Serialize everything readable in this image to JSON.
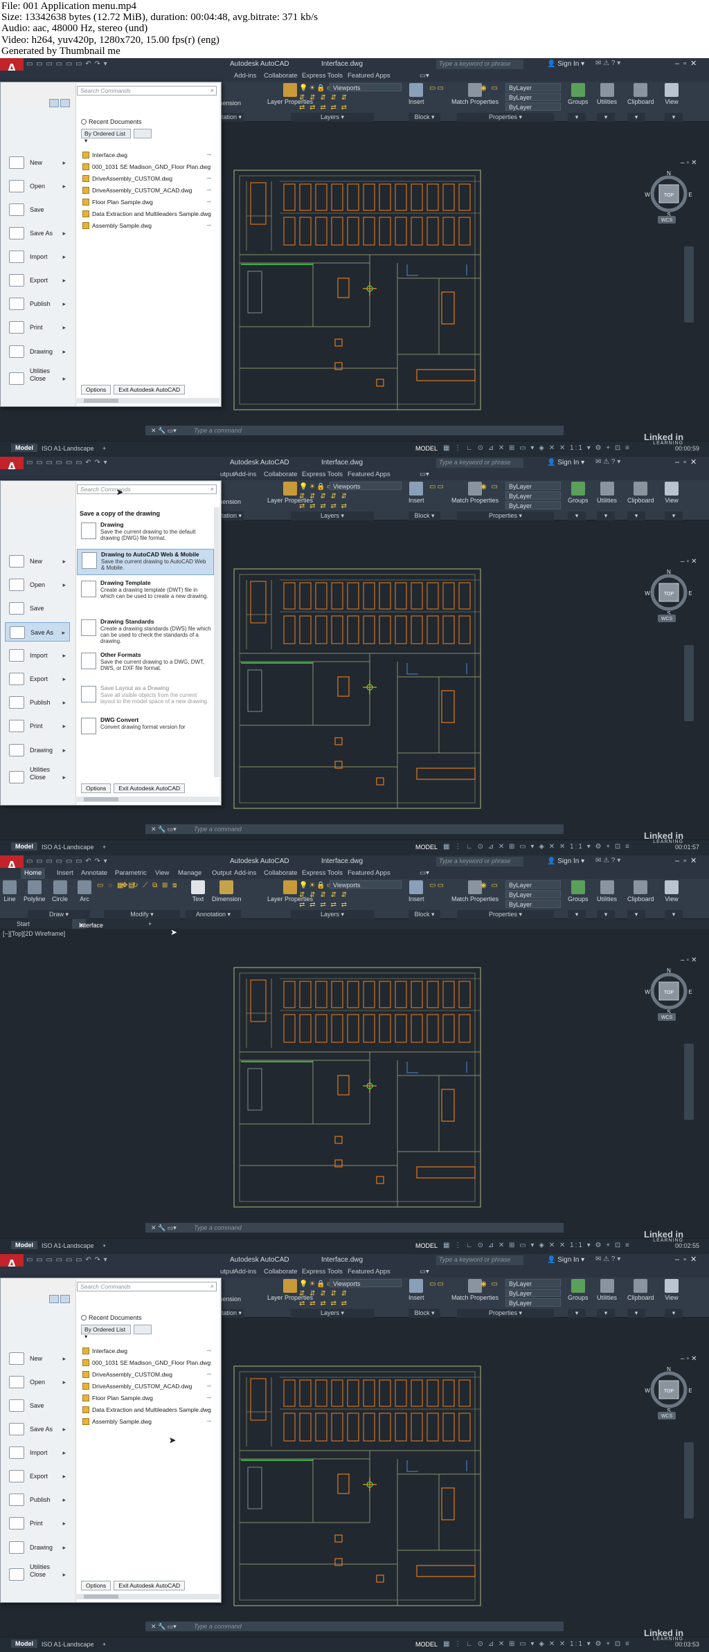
{
  "header": {
    "lines": [
      "File: 001 Application menu.mp4",
      "Size: 13342638 bytes (12.72 MiB), duration: 00:04:48, avg.bitrate: 371 kb/s",
      "Audio: aac, 48000 Hz, stereo (und)",
      "Video: h264, yuv420p, 1280x720, 15.00 fps(r) (eng)",
      "Generated by Thumbnail me"
    ]
  },
  "app": {
    "title": "Autodesk AutoCAD",
    "document": "Interface.dwg",
    "search_placeholder": "Type a keyword or phrase",
    "sign_in": "Sign In",
    "app_button": "A",
    "ribbon_tabs": [
      "Home",
      "Insert",
      "Annotate",
      "Parametric",
      "View",
      "Manage",
      "Output",
      "Add-ins",
      "Collaborate",
      "Express Tools",
      "Featured Apps"
    ],
    "ribbon_tabs_partial": [
      "Add-ins",
      "Collaborate",
      "Express Tools",
      "Featured Apps"
    ],
    "ribbon_tabs_partial_mid": [
      "utput",
      "Add-ins",
      "Collaborate",
      "Express Tools",
      "Featured Apps"
    ],
    "tools": {
      "line": "Line",
      "polyline": "Polyline",
      "circle": "Circle",
      "arc": "Arc",
      "text": "Text",
      "dimension": "Dimension",
      "dimension_partial": "imension",
      "layer_properties": "Layer Properties",
      "insert": "Insert",
      "match_properties": "Match Properties",
      "groups": "Groups",
      "utilities": "Utilities",
      "clipboard": "Clipboard",
      "view": "View"
    },
    "panels": {
      "draw": "Draw",
      "modify": "Modify",
      "annotation": "Annotation",
      "annotation_partial": "otation",
      "layers": "Layers",
      "block": "Block",
      "properties": "Properties"
    },
    "combos": {
      "viewports": "Viewports",
      "bylayer": "ByLayer"
    },
    "doc_tabs": {
      "start": "Start",
      "interface": "Interface",
      "plus": "+"
    },
    "viewport_label": "[−][Top][2D Wireframe]",
    "viewcube": {
      "n": "N",
      "s": "S",
      "e": "E",
      "w": "W",
      "top": "TOP",
      "wcs": "WCS"
    },
    "command_placeholder": "Type a command",
    "status": {
      "model_tab": "Model",
      "layout_tab": "ISO A1-Landscape",
      "add": "+",
      "model_right": "MODEL",
      "scale": "1:1"
    },
    "watermark": {
      "brand": "Linked in",
      "sub": "LEARNING"
    },
    "timecodes": [
      "00:00:59",
      "00:01:57",
      "00:02:55",
      "00:03:53"
    ]
  },
  "app_menu": {
    "search_placeholder": "Search Commands",
    "items": [
      "New",
      "Open",
      "Save",
      "Save As",
      "Import",
      "Export",
      "Publish",
      "Print",
      "Drawing Utilities",
      "Close"
    ],
    "recent_header": "Recent Documents",
    "order_by": "By Ordered List",
    "recent_files": [
      "Interface.dwg",
      "000_1031 SE Madison_GND_Floor Plan.dwg",
      "DriveAssembly_CUSTOM.dwg",
      "DriveAssembly_CUSTOM_ACAD.dwg",
      "Floor Plan Sample.dwg",
      "Data Extraction and Multileaders Sample.dwg",
      "Assembly Sample.dwg"
    ],
    "options": "Options",
    "exit": "Exit Autodesk AutoCAD"
  },
  "save_as": {
    "title": "Save a copy of the drawing",
    "options": [
      {
        "title": "Drawing",
        "desc": "Save the current drawing to the default drawing (DWG) file format."
      },
      {
        "title": "Drawing to AutoCAD Web & Mobile",
        "desc": "Save the current drawing to AutoCAD Web & Mobile."
      },
      {
        "title": "Drawing Template",
        "desc": "Create a drawing template (DWT) file in which can be used to create a new drawing."
      },
      {
        "title": "Drawing Standards",
        "desc": "Create a drawing standards (DWS) file which can be used to check the standards of a drawing."
      },
      {
        "title": "Other Formats",
        "desc": "Save the current drawing to a DWG, DWT, DWS, or DXF file format."
      },
      {
        "title": "Save Layout as a Drawing",
        "desc": "Save all visible objects from the current layout to the model space of a new drawing."
      },
      {
        "title": "DWG Convert",
        "desc": "Convert drawing format version for"
      }
    ]
  },
  "colors": {
    "app_red": "#c3232b",
    "canvas": "#212830",
    "ribbon": "#323c48",
    "wall_lines": "#8b8f6a",
    "furniture": "#e07a1f",
    "highlight_green": "#3fdc4a",
    "menu_selected": "#c8dcf0"
  }
}
